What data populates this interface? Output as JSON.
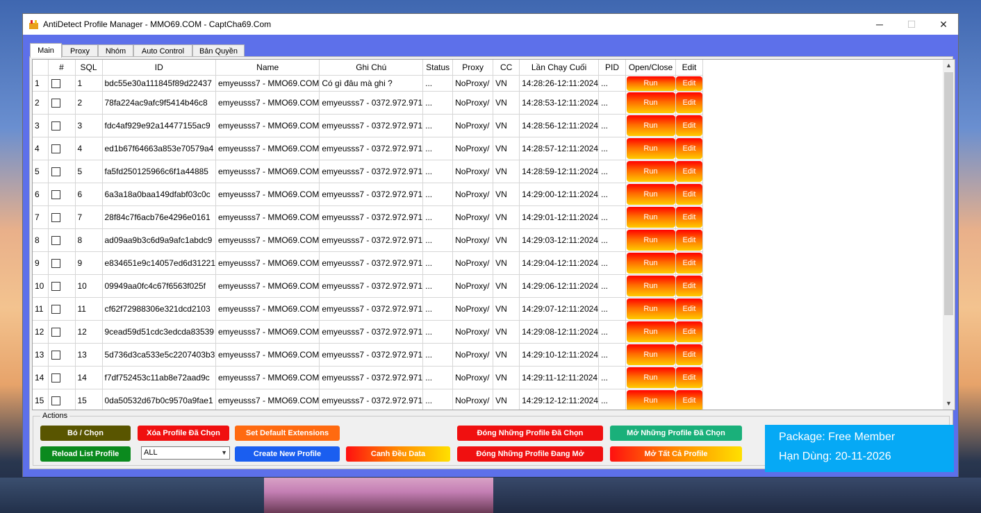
{
  "window": {
    "title": "AntiDetect Profile Manager - MMO69.COM - CaptCha69.Com",
    "controls": {
      "minimize": "─",
      "maximize": "☐",
      "close": "✕"
    }
  },
  "tabs": [
    "Main",
    "Proxy",
    "Nhóm",
    "Auto Control",
    "Bản Quyền"
  ],
  "grid": {
    "headers": [
      "",
      "#",
      "SQL",
      "ID",
      "Name",
      "Ghi Chú",
      "Status",
      "Proxy",
      "CC",
      "Lần Chạy Cuối",
      "PID",
      "Open/Close",
      "Edit"
    ],
    "run_label": "Run",
    "edit_label": "Edit",
    "rows": [
      {
        "n": "1",
        "sql": "1",
        "id": "bdc55e30a111845f89d22437",
        "name": "emyeusss7 - MMO69.COM",
        "note": "Có gì đâu mà ghi ?",
        "status": "...",
        "proxy": "NoProxy/",
        "cc": "VN",
        "last": "14:28:26-12:11:2024",
        "pid": "..."
      },
      {
        "n": "2",
        "sql": "2",
        "id": "78fa224ac9afc9f5414b46c8",
        "name": "emyeusss7 - MMO69.COM",
        "note": "emyeusss7 - 0372.972.971",
        "status": "...",
        "proxy": "NoProxy/",
        "cc": "VN",
        "last": "14:28:53-12:11:2024",
        "pid": "..."
      },
      {
        "n": "3",
        "sql": "3",
        "id": "fdc4af929e92a14477155ac9",
        "name": "emyeusss7 - MMO69.COM",
        "note": "emyeusss7 - 0372.972.971",
        "status": "...",
        "proxy": "NoProxy/",
        "cc": "VN",
        "last": "14:28:56-12:11:2024",
        "pid": "..."
      },
      {
        "n": "4",
        "sql": "4",
        "id": "ed1b67f64663a853e70579a4",
        "name": "emyeusss7 - MMO69.COM",
        "note": "emyeusss7 - 0372.972.971",
        "status": "...",
        "proxy": "NoProxy/",
        "cc": "VN",
        "last": "14:28:57-12:11:2024",
        "pid": "..."
      },
      {
        "n": "5",
        "sql": "5",
        "id": "fa5fd250125966c6f1a44885",
        "name": "emyeusss7 - MMO69.COM",
        "note": "emyeusss7 - 0372.972.971",
        "status": "...",
        "proxy": "NoProxy/",
        "cc": "VN",
        "last": "14:28:59-12:11:2024",
        "pid": "..."
      },
      {
        "n": "6",
        "sql": "6",
        "id": "6a3a18a0baa149dfabf03c0c",
        "name": "emyeusss7 - MMO69.COM",
        "note": "emyeusss7 - 0372.972.971",
        "status": "...",
        "proxy": "NoProxy/",
        "cc": "VN",
        "last": "14:29:00-12:11:2024",
        "pid": "..."
      },
      {
        "n": "7",
        "sql": "7",
        "id": "28f84c7f6acb76e4296e0161",
        "name": "emyeusss7 - MMO69.COM",
        "note": "emyeusss7 - 0372.972.971",
        "status": "...",
        "proxy": "NoProxy/",
        "cc": "VN",
        "last": "14:29:01-12:11:2024",
        "pid": "..."
      },
      {
        "n": "8",
        "sql": "8",
        "id": "ad09aa9b3c6d9a9afc1abdc9",
        "name": "emyeusss7 - MMO69.COM",
        "note": "emyeusss7 - 0372.972.971",
        "status": "...",
        "proxy": "NoProxy/",
        "cc": "VN",
        "last": "14:29:03-12:11:2024",
        "pid": "..."
      },
      {
        "n": "9",
        "sql": "9",
        "id": "e834651e9c14057ed6d31221",
        "name": "emyeusss7 - MMO69.COM",
        "note": "emyeusss7 - 0372.972.971",
        "status": "...",
        "proxy": "NoProxy/",
        "cc": "VN",
        "last": "14:29:04-12:11:2024",
        "pid": "..."
      },
      {
        "n": "10",
        "sql": "10",
        "id": "09949aa0fc4c67f6563f025f",
        "name": "emyeusss7 - MMO69.COM",
        "note": "emyeusss7 - 0372.972.971",
        "status": "...",
        "proxy": "NoProxy/",
        "cc": "VN",
        "last": "14:29:06-12:11:2024",
        "pid": "..."
      },
      {
        "n": "11",
        "sql": "11",
        "id": "cf62f72988306e321dcd2103",
        "name": "emyeusss7 - MMO69.COM",
        "note": "emyeusss7 - 0372.972.971",
        "status": "...",
        "proxy": "NoProxy/",
        "cc": "VN",
        "last": "14:29:07-12:11:2024",
        "pid": "..."
      },
      {
        "n": "12",
        "sql": "12",
        "id": "9cead59d51cdc3edcda83539",
        "name": "emyeusss7 - MMO69.COM",
        "note": "emyeusss7 - 0372.972.971",
        "status": "...",
        "proxy": "NoProxy/",
        "cc": "VN",
        "last": "14:29:08-12:11:2024",
        "pid": "..."
      },
      {
        "n": "13",
        "sql": "13",
        "id": "5d736d3ca533e5c2207403b3",
        "name": "emyeusss7 - MMO69.COM",
        "note": "emyeusss7 - 0372.972.971",
        "status": "...",
        "proxy": "NoProxy/",
        "cc": "VN",
        "last": "14:29:10-12:11:2024",
        "pid": "..."
      },
      {
        "n": "14",
        "sql": "14",
        "id": "f7df752453c11ab8e72aad9c",
        "name": "emyeusss7 - MMO69.COM",
        "note": "emyeusss7 - 0372.972.971",
        "status": "...",
        "proxy": "NoProxy/",
        "cc": "VN",
        "last": "14:29:11-12:11:2024",
        "pid": "..."
      },
      {
        "n": "15",
        "sql": "15",
        "id": "0da50532d67b0c9570a9fae1",
        "name": "emyeusss7 - MMO69.COM",
        "note": "emyeusss7 - 0372.972.971",
        "status": "...",
        "proxy": "NoProxy/",
        "cc": "VN",
        "last": "14:29:12-12:11:2024",
        "pid": "..."
      }
    ]
  },
  "actions": {
    "legend": "Actions",
    "bo_chon": "Bó / Chọn",
    "reload": "Reload List Profile",
    "xoa": "Xóa Profile Đã Chọn",
    "group_select": "ALL",
    "set_default_ext": "Set Default Extensions",
    "create_new": "Create New Profile",
    "canh_deu": "Canh Đều Data",
    "dong_da_chon": "Đóng Những Profile Đã Chọn",
    "dong_dang_mo": "Đóng Những Profile Đang Mở",
    "mo_da_chon": "Mở Những Profile Đã Chọn",
    "mo_tat_ca": "Mở Tất Cả Profile"
  },
  "package": {
    "line1": "Package: Free Member",
    "line2": "Hạn Dùng: 20-11-2026"
  },
  "colors": {
    "accent_bar": "#5d70ea",
    "olive": "#595500",
    "red": "#f01010",
    "orange": "#ff6a10",
    "blue": "#1a5ef0",
    "green": "#0b8a1e",
    "teal": "#1ab07a",
    "package_bg": "#06a9f5"
  }
}
